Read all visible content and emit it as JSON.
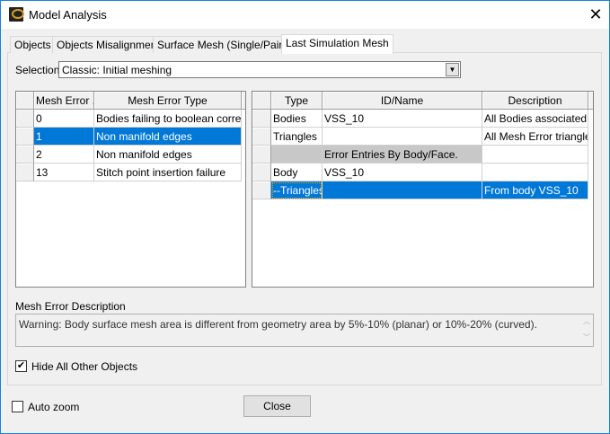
{
  "window": {
    "title": "Model Analysis",
    "close_glyph": "✕"
  },
  "tabs": [
    {
      "label": "Objects"
    },
    {
      "label": "Objects Misalignment"
    },
    {
      "label": "Surface Mesh (Single/Pairs)"
    },
    {
      "label": "Last Simulation Mesh",
      "active": true
    }
  ],
  "selection": {
    "label": "Selection:",
    "value": "Classic: Initial meshing"
  },
  "left_table": {
    "columns": [
      "Mesh Error ...",
      "Mesh Error Type"
    ],
    "rows": [
      [
        "0",
        "Bodies failing to boolean correctly"
      ],
      [
        "1",
        "Non manifold edges"
      ],
      [
        "2",
        "Non manifold edges"
      ],
      [
        "13",
        "Stitch point insertion failure"
      ]
    ],
    "selected_row": 1
  },
  "right_table": {
    "columns": [
      "Type",
      "ID/Name",
      "Description"
    ],
    "rows": [
      [
        "Bodies",
        "VSS_10",
        "All Bodies associated ..."
      ],
      [
        "Triangles",
        "",
        "All Mesh Error triangle..."
      ],
      [
        "",
        "Error Entries By Body/Face.",
        ""
      ],
      [
        "Body",
        "VSS_10",
        ""
      ],
      [
        "--Triangles",
        "",
        "From body VSS_10"
      ]
    ],
    "selected_row": 4
  },
  "description": {
    "label": "Mesh Error Description",
    "text": "Warning: Body surface mesh area is different from geometry area by 5%-10% (planar) or 10%-20% (curved)."
  },
  "hide_others": {
    "label": "Hide All Other Objects",
    "checked": true
  },
  "auto_zoom": {
    "label": "Auto zoom",
    "checked": false
  },
  "close_button": "Close",
  "colors": {
    "selection": "#0078d7",
    "accent_border": "#1883d7"
  }
}
